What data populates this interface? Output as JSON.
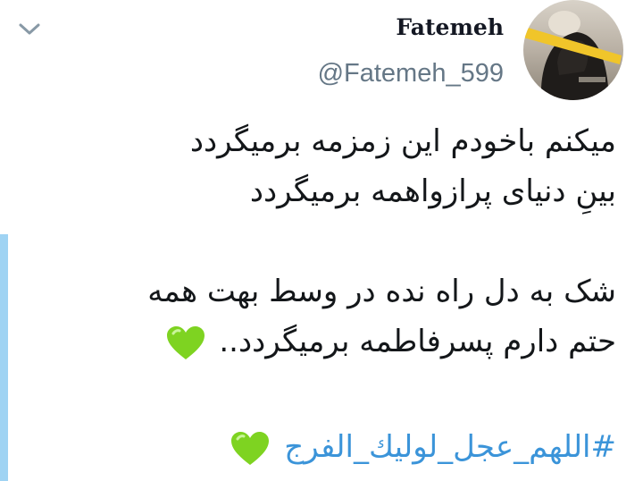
{
  "tweet": {
    "author": {
      "display_name": "Fatemeh",
      "handle": "@Fatemeh_599"
    },
    "body_lines": [
      "میکنم باخودم این زمزمه برمیگردد",
      "بینِ دنیای پرازواهمه برمیگردد",
      "شک به دل راه نده در وسط بهت همه",
      "حتم دارم پسرفاطمه برمیگردد.."
    ],
    "hashtag": "#اللهم_عجل_لولیك_الفرج",
    "emoji": "green-heart",
    "colors": {
      "link": "#3b94d9",
      "handle": "#657786",
      "thread_line": "#9fd3f3",
      "heart": "#7ed321"
    }
  },
  "icons": {
    "menu": "chevron-down-icon",
    "emoji": "green-heart-icon"
  }
}
